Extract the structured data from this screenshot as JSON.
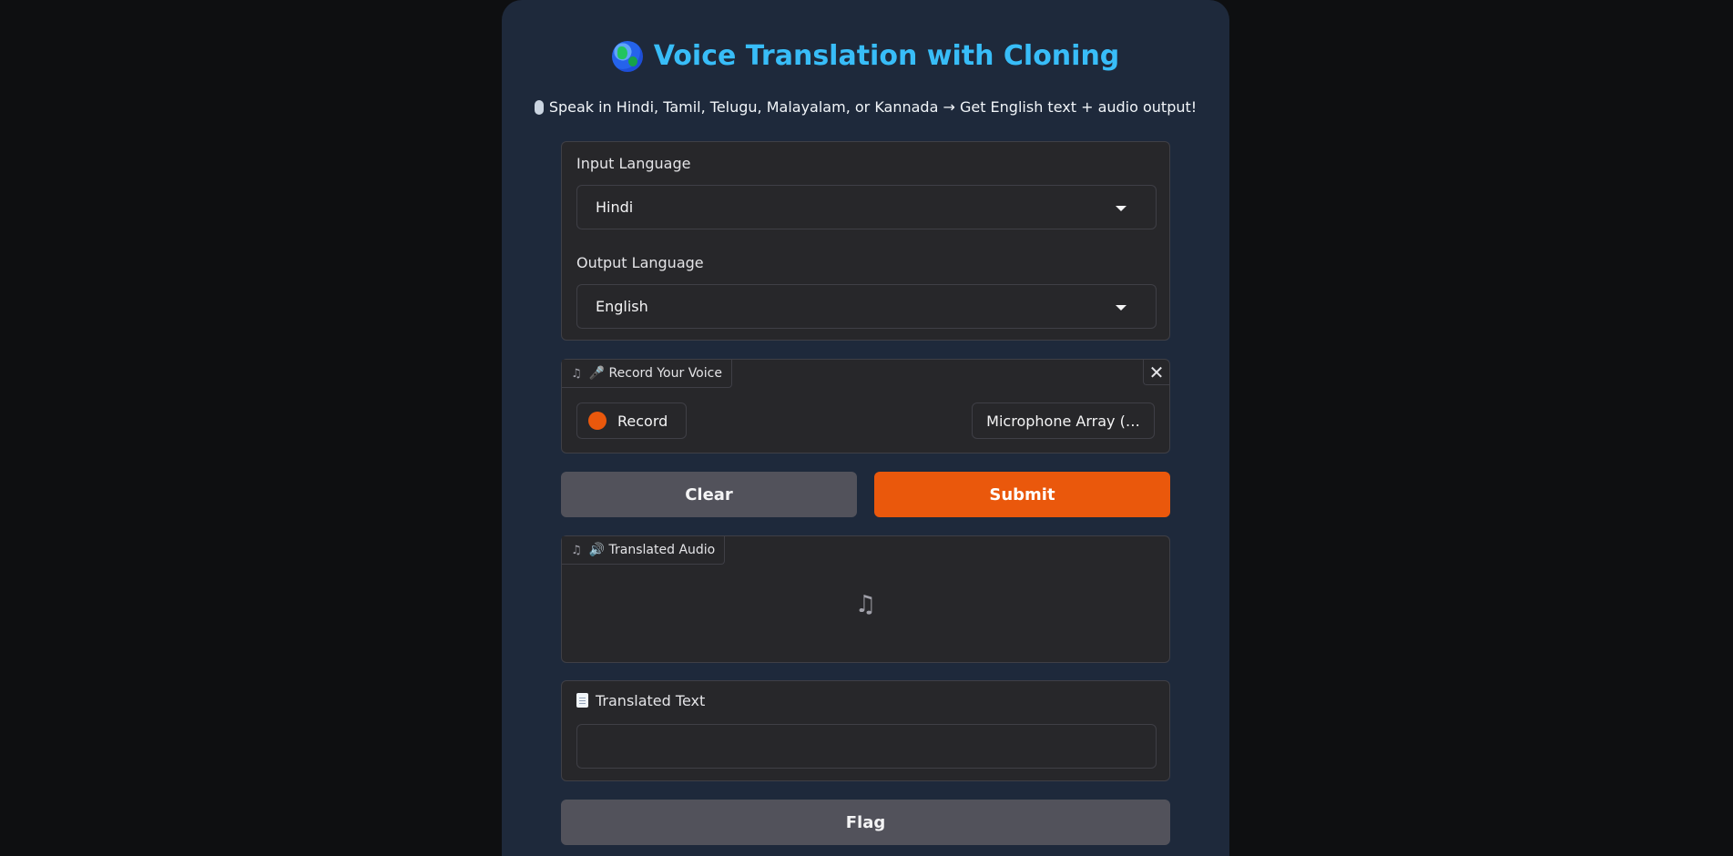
{
  "header": {
    "title": "Voice Translation with Cloning",
    "title_icon": "globe-icon",
    "subtitle": "Speak in Hindi, Tamil, Telugu, Malayalam, or Kannada → Get English text + audio output!",
    "subtitle_icon": "microphone-icon"
  },
  "languages": {
    "input_label": "Input Language",
    "input_value": "Hindi",
    "output_label": "Output Language",
    "output_value": "English"
  },
  "recorder": {
    "label": "🎤 Record Your Voice",
    "record_label": "Record",
    "device_label": "Microphone Array (…",
    "close_symbol": "✕"
  },
  "actions": {
    "clear_label": "Clear",
    "submit_label": "Submit",
    "flag_label": "Flag"
  },
  "output_audio": {
    "label": "🔊 Translated Audio",
    "placeholder_icon": "♫"
  },
  "output_text": {
    "label": "Translated Text",
    "label_icon": "document-icon",
    "value": ""
  },
  "colors": {
    "accent": "#ea580c",
    "title": "#38bdf8",
    "panel_bg": "#27272a",
    "container_bg": "#1e293b",
    "page_bg": "#0e0f11"
  }
}
